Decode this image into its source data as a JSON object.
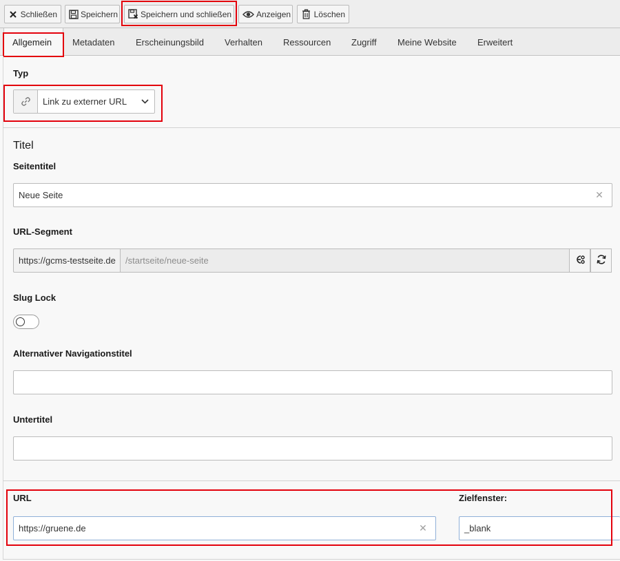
{
  "toolbar": {
    "close_label": "Schließen",
    "save_label": "Speichern",
    "save_close_label": "Speichern und schließen",
    "view_label": "Anzeigen",
    "delete_label": "Löschen"
  },
  "tabs": [
    {
      "label": "Allgemein",
      "active": true
    },
    {
      "label": "Metadaten"
    },
    {
      "label": "Erscheinungsbild"
    },
    {
      "label": "Verhalten"
    },
    {
      "label": "Ressourcen"
    },
    {
      "label": "Zugriff"
    },
    {
      "label": "Meine Website"
    },
    {
      "label": "Erweitert"
    }
  ],
  "type_section": {
    "label": "Typ",
    "selected": "Link zu externer URL",
    "addon_icon": "link-icon"
  },
  "title_section": {
    "heading": "Titel",
    "page_title_label": "Seitentitel",
    "page_title_value": "Neue Seite",
    "url_segment_label": "URL-Segment",
    "url_prefix": "https://gcms-testseite.de",
    "url_slug": "/startseite/neue-seite",
    "slug_lock_label": "Slug Lock",
    "slug_lock_on": false,
    "alt_nav_title_label": "Alternativer Navigationstitel",
    "alt_nav_title_value": "",
    "subtitle_label": "Untertitel",
    "subtitle_value": ""
  },
  "link_section": {
    "url_label": "URL",
    "url_value": "https://gruene.de",
    "target_label": "Zielfenster:",
    "target_value": "_blank"
  },
  "colors": {
    "highlight": "#e3000b",
    "focus_border": "#8fb0d8"
  }
}
